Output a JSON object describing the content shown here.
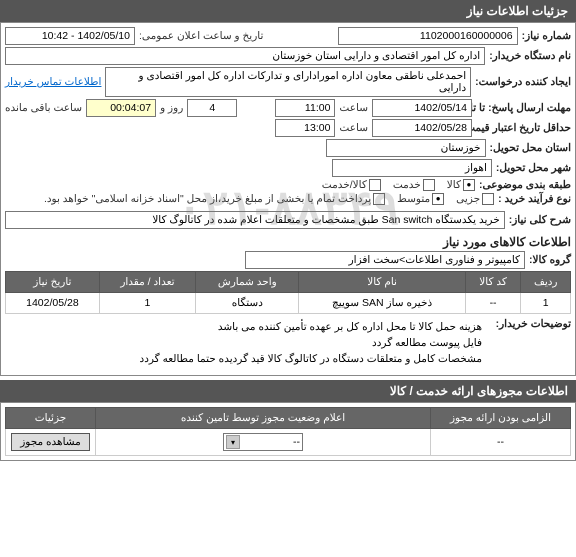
{
  "header": {
    "title": "جزئیات اطلاعات نیاز"
  },
  "fields": {
    "need_number_label": "شماره نیاز:",
    "need_number_value": "1102000160000006",
    "announce_datetime_label": "تاریخ و ساعت اعلان عمومی:",
    "announce_datetime_value": "1402/05/10 - 10:42",
    "buyer_org_label": "نام دستگاه خریدار:",
    "buyer_org_value": "اداره کل امور اقتصادی و دارایی استان خوزستان",
    "requester_label": "ایجاد کننده درخواست:",
    "requester_value": "احمدعلی ناطقی معاون اداره امورادارای و تدارکات اداره کل امور اقتصادی و دارایی",
    "contact_link": "اطلاعات تماس خریدار",
    "deadline_label": "مهلت ارسال پاسخ: تا تاریخ:",
    "deadline_date": "1402/05/14",
    "time_label": "ساعت",
    "deadline_time": "11:00",
    "days_count": "4",
    "days_label": "روز و",
    "remaining_time": "00:04:07",
    "remaining_label": "ساعت باقی مانده",
    "validity_label": "حداقل تاریخ اعتبار قیمت: تا تاریخ:",
    "validity_date": "1402/05/28",
    "validity_time": "13:00",
    "province_label": "استان محل تحویل:",
    "province_value": "خوزستان",
    "city_label": "شهر محل تحویل:",
    "city_value": "اهواز",
    "category_label": "طبقه بندی موضوعی:",
    "cat_goods": "کالا",
    "cat_service": "خدمت",
    "cat_goods_service": "کالا/خدمت",
    "purchase_type_label": "نوع فرآیند خرید :",
    "pt_small": "جزیی",
    "pt_medium": "متوسط",
    "purchase_note": "پرداخت تمام یا بخشی از مبلغ خرید،از محل \"اسناد خزانه اسلامی\" خواهد بود.",
    "need_desc_label": "شرح کلی نیاز:",
    "need_desc_value": "خرید یکدستگاه San switch طبق مشخصات و متعلقات اعلام شده در کاتالوگ کالا"
  },
  "goods_section": {
    "title": "اطلاعات کالاهای مورد نیاز",
    "group_label": "گروه کالا:",
    "group_value": "کامپیوتر و فناوری اطلاعات>سخت افزار",
    "columns": {
      "row": "ردیف",
      "code": "کد کالا",
      "name": "نام کالا",
      "unit": "واحد شمارش",
      "qty": "تعداد / مقدار",
      "date": "تاریخ نیاز"
    },
    "rows": [
      {
        "row": "1",
        "code": "--",
        "name": "ذخیره ساز SAN سوییچ",
        "unit": "دستگاه",
        "qty": "1",
        "date": "1402/05/28"
      }
    ],
    "notes_label": "توضیحات خریدار:",
    "notes_line1": "هزینه حمل کالا تا محل اداره کل بر عهده تأمین کننده می باشد",
    "notes_line2": "فایل پیوست مطالعه گردد",
    "notes_line3": "مشخصات کامل و متعلقات دستگاه در کاتالوگ کالا قید گردیده حتما مطالعه گردد"
  },
  "license_section": {
    "title": "اطلاعات مجوزهای ارائه خدمت / کالا",
    "columns": {
      "mandatory": "الزامی بودن ارائه مجوز",
      "status": "اعلام وضعیت مجوز توسط تامین کننده",
      "details": "جزئیات"
    },
    "row": {
      "mandatory": "--",
      "status": "--",
      "button": "مشاهده مجوز"
    }
  },
  "watermark": "۰۲۱-۸۸۳۴۹"
}
